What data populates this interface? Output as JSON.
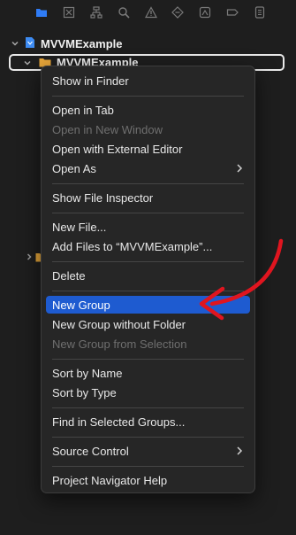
{
  "toolbar": {
    "icons": [
      "folder-icon",
      "source-control-icon",
      "symbol-icon",
      "find-icon",
      "issue-icon",
      "test-icon",
      "debug-icon",
      "breakpoint-icon",
      "report-icon"
    ],
    "active_color": "#2f7cf6"
  },
  "navigator": {
    "project_name": "MVVMExample",
    "group_name": "MVVMExample"
  },
  "context_menu": {
    "items": [
      {
        "label": "Show in Finder",
        "enabled": true
      },
      {
        "label": "Open in Tab",
        "enabled": true
      },
      {
        "label": "Open in New Window",
        "enabled": false
      },
      {
        "label": "Open with External Editor",
        "enabled": true
      },
      {
        "label": "Open As",
        "enabled": true,
        "submenu": true
      },
      {
        "label": "Show File Inspector",
        "enabled": true
      },
      {
        "label": "New File...",
        "enabled": true
      },
      {
        "label": "Add Files to “MVVMExample”...",
        "enabled": true
      },
      {
        "label": "Delete",
        "enabled": true
      },
      {
        "label": "New Group",
        "enabled": true,
        "highlighted": true
      },
      {
        "label": "New Group without Folder",
        "enabled": true
      },
      {
        "label": "New Group from Selection",
        "enabled": false
      },
      {
        "label": "Sort by Name",
        "enabled": true
      },
      {
        "label": "Sort by Type",
        "enabled": true
      },
      {
        "label": "Find in Selected Groups...",
        "enabled": true
      },
      {
        "label": "Source Control",
        "enabled": true,
        "submenu": true
      },
      {
        "label": "Project Navigator Help",
        "enabled": true
      }
    ]
  },
  "colors": {
    "highlight": "#1e5bd0",
    "annotation_arrow": "#e0151f",
    "folder": "#e8a73a"
  }
}
